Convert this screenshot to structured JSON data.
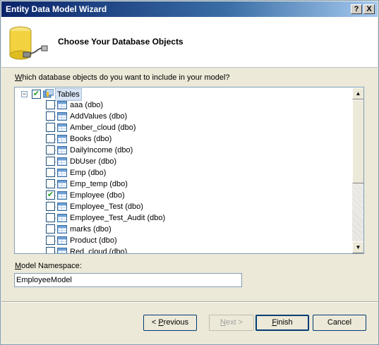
{
  "window": {
    "title": "Entity Data Model Wizard",
    "help_label": "?",
    "close_label": "X"
  },
  "header": {
    "title": "Choose Your Database Objects"
  },
  "prompt": {
    "text": "Which database objects do you want to include in your model?"
  },
  "tree": {
    "root": {
      "label": "Tables",
      "checked": true,
      "expanded": true
    },
    "items": [
      {
        "label": "aaa (dbo)",
        "checked": false
      },
      {
        "label": "AddValues (dbo)",
        "checked": false
      },
      {
        "label": "Amber_cloud (dbo)",
        "checked": false
      },
      {
        "label": "Books (dbo)",
        "checked": false
      },
      {
        "label": "DailyIncome (dbo)",
        "checked": false
      },
      {
        "label": "DbUser (dbo)",
        "checked": false
      },
      {
        "label": "Emp (dbo)",
        "checked": false
      },
      {
        "label": "Emp_temp (dbo)",
        "checked": false
      },
      {
        "label": "Employee (dbo)",
        "checked": true
      },
      {
        "label": "Employee_Test (dbo)",
        "checked": false
      },
      {
        "label": "Employee_Test_Audit (dbo)",
        "checked": false
      },
      {
        "label": "marks (dbo)",
        "checked": false
      },
      {
        "label": "Product (dbo)",
        "checked": false
      },
      {
        "label": "Red_cloud (dbo)",
        "checked": false
      }
    ]
  },
  "namespace": {
    "label": "Model Namespace:",
    "value": "EmployeeModel"
  },
  "buttons": {
    "previous": "< Previous",
    "next": "Next >",
    "finish": "Finish",
    "cancel": "Cancel"
  },
  "colors": {
    "title_bar_start": "#0a246a",
    "title_bar_end": "#a6caf0",
    "dialog_background": "#ece9d8",
    "check_mark": "#21a121"
  }
}
